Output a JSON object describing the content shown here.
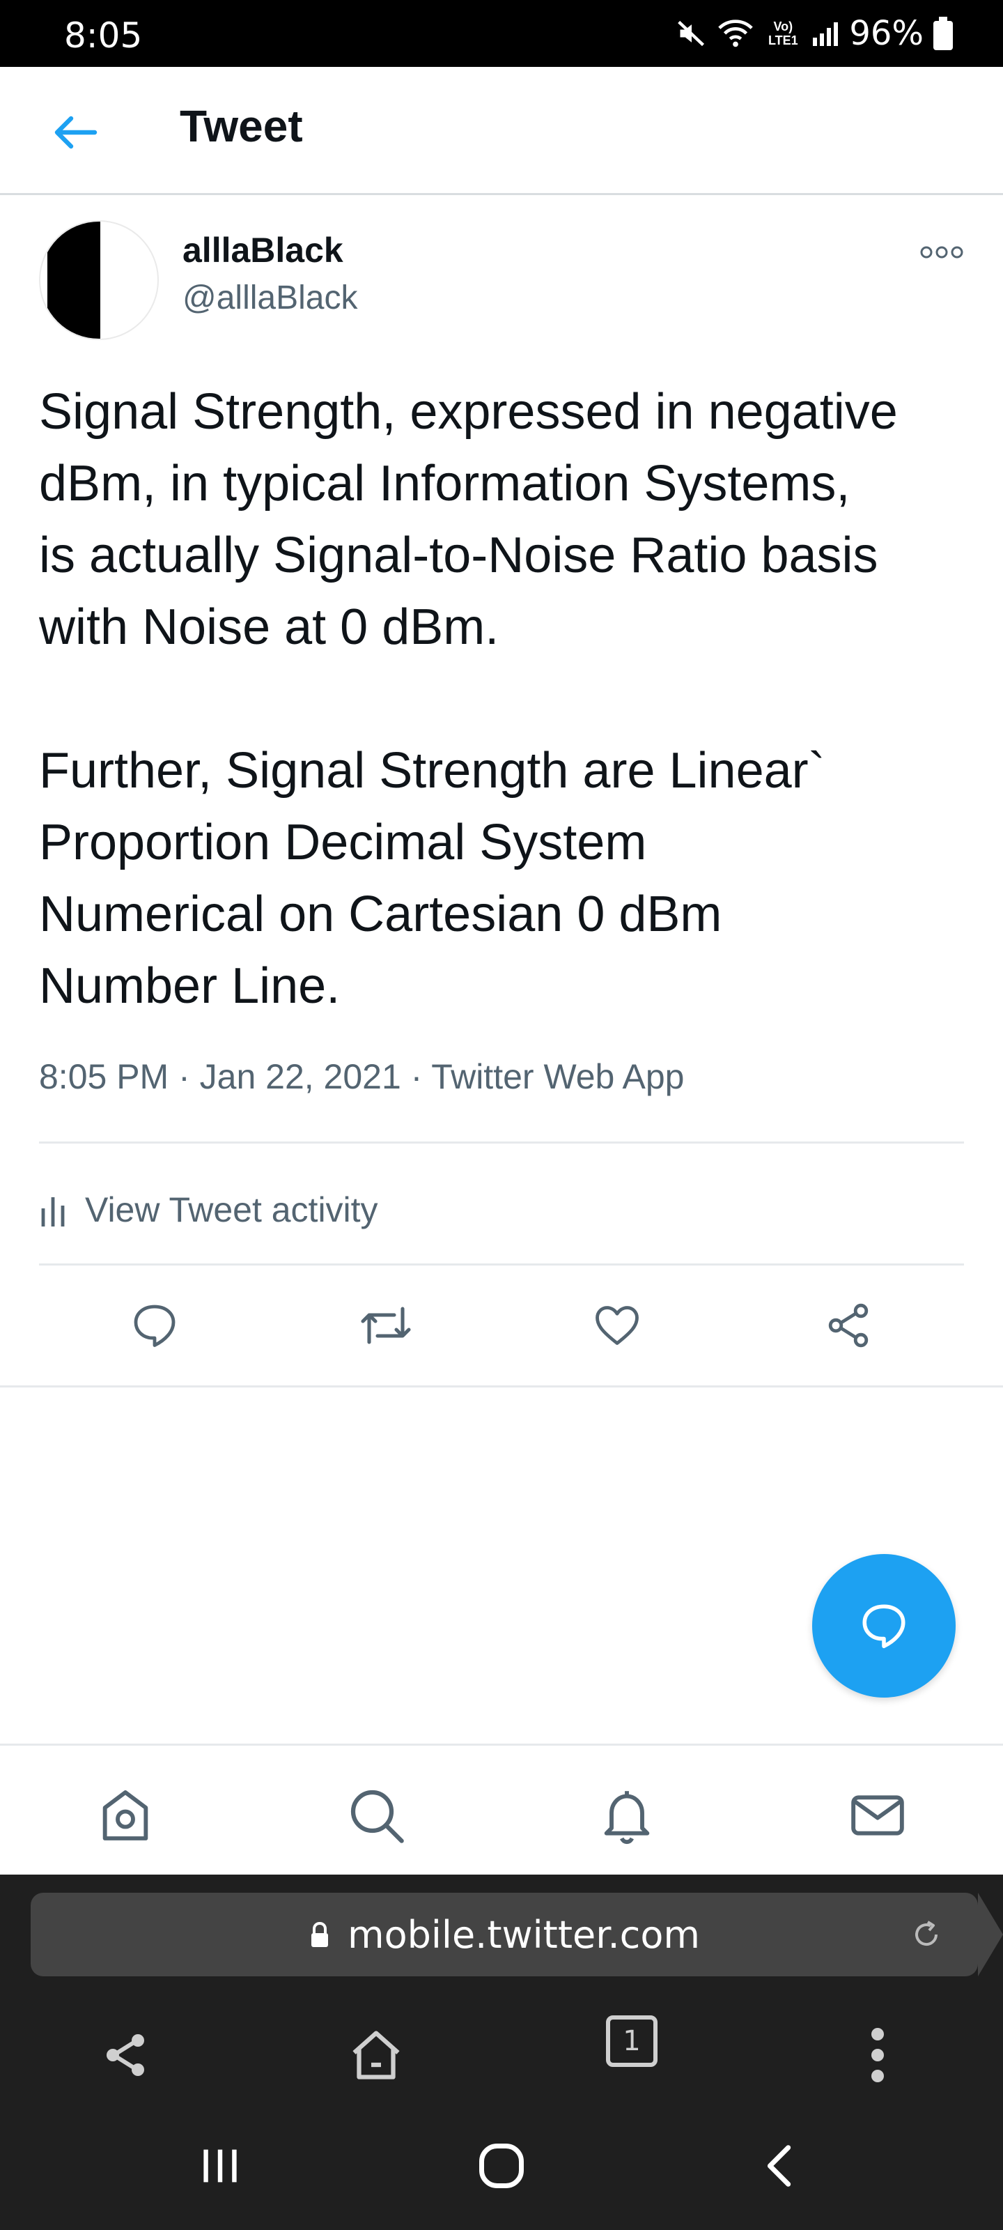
{
  "status_bar": {
    "time": "8:05",
    "battery": "96%",
    "network": "Vo) LTE1"
  },
  "header": {
    "title": "Tweet"
  },
  "tweet": {
    "display_name": "alllaBlack",
    "handle": "@alllaBlack",
    "paragraph_1": [
      "Signal Strength, expressed in negative",
      "dBm, in typical Information Systems,",
      "is actually Signal-to-Noise Ratio basis",
      "with Noise at 0 dBm."
    ],
    "paragraph_2": [
      "Further, Signal Strength are Linear`",
      "Proportion Decimal System",
      "Numerical on Cartesian 0 dBm",
      "Number Line."
    ],
    "meta": "8:05 PM · Jan 22, 2021 · Twitter Web App",
    "activity_label": "View Tweet activity"
  },
  "actions": [
    "reply-icon",
    "retweet-icon",
    "like-icon",
    "share-icon"
  ],
  "tabbar": [
    "home-icon",
    "search-icon",
    "notifications-icon",
    "messages-icon"
  ],
  "browser": {
    "url": "mobile.twitter.com",
    "tab_count": "1"
  },
  "colors": {
    "accent": "#1da1f2",
    "secondary_text": "#536471",
    "divider": "#e6e9ec",
    "browser_bg": "#1f1f1f",
    "urlbar_bg": "#444444"
  }
}
